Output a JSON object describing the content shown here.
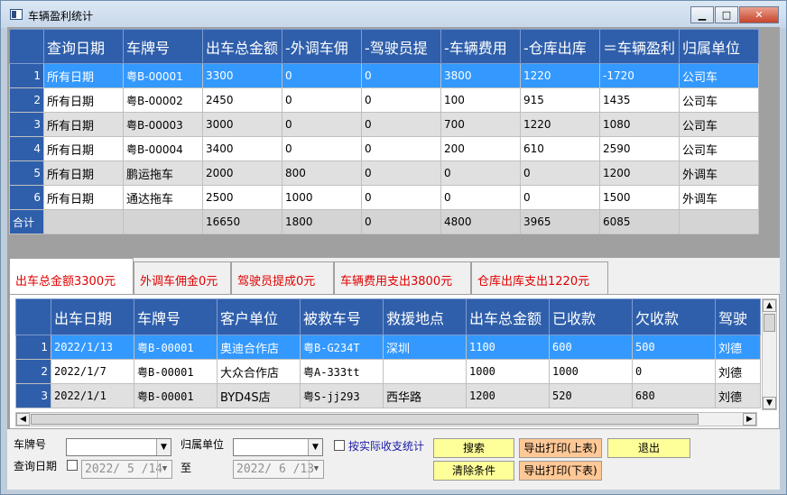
{
  "window": {
    "title": "车辆盈利统计"
  },
  "summary_table": {
    "columns": [
      "查询日期",
      "车牌号",
      "出车总金额",
      "-外调车佣",
      "-驾驶员提",
      "-车辆费用",
      "-仓库出库",
      "＝车辆盈利",
      "归属单位"
    ],
    "rows": [
      {
        "n": "1",
        "cells": [
          "所有日期",
          "粤B-00001",
          "3300",
          "0",
          "0",
          "3800",
          "1220",
          "-1720",
          "公司车"
        ]
      },
      {
        "n": "2",
        "cells": [
          "所有日期",
          "粤B-00002",
          "2450",
          "0",
          "0",
          "100",
          "915",
          "1435",
          "公司车"
        ]
      },
      {
        "n": "3",
        "cells": [
          "所有日期",
          "粤B-00003",
          "3000",
          "0",
          "0",
          "700",
          "1220",
          "1080",
          "公司车"
        ]
      },
      {
        "n": "4",
        "cells": [
          "所有日期",
          "粤B-00004",
          "3400",
          "0",
          "0",
          "200",
          "610",
          "2590",
          "公司车"
        ]
      },
      {
        "n": "5",
        "cells": [
          "所有日期",
          "鹏运拖车",
          "2000",
          "800",
          "0",
          "0",
          "0",
          "1200",
          "外调车"
        ]
      },
      {
        "n": "6",
        "cells": [
          "所有日期",
          "通达拖车",
          "2500",
          "1000",
          "0",
          "0",
          "0",
          "1500",
          "外调车"
        ]
      }
    ],
    "total": {
      "label": "合计",
      "cells": [
        "",
        "",
        "16650",
        "1800",
        "0",
        "4800",
        "3965",
        "6085",
        ""
      ]
    }
  },
  "tabs": [
    "出车总金额3300元",
    "外调车佣金0元",
    "驾驶员提成0元",
    "车辆费用支出3800元",
    "仓库出库支出1220元"
  ],
  "detail_table": {
    "columns": [
      "出车日期",
      "车牌号",
      "客户单位",
      "被救车号",
      "救援地点",
      "出车总金额",
      "已收款",
      "欠收款",
      "驾驶"
    ],
    "rows": [
      {
        "n": "1",
        "cells": [
          "2022/1/13",
          "粤B-00001",
          "奥迪合作店",
          "粤B-G234T",
          "深圳",
          "1100",
          "600",
          "500",
          "刘德"
        ]
      },
      {
        "n": "2",
        "cells": [
          "2022/1/7",
          "粤B-00001",
          "大众合作店",
          "粤A-333tt",
          "",
          "1000",
          "1000",
          "0",
          "刘德"
        ]
      },
      {
        "n": "3",
        "cells": [
          "2022/1/1",
          "粤B-00001",
          "BYD4S店",
          "粤S-jj293",
          "西华路",
          "1200",
          "520",
          "680",
          "刘德"
        ]
      }
    ]
  },
  "filters": {
    "plate_label": "车牌号",
    "date_label": "查询日期",
    "unit_label": "归属单位",
    "to_label": "至",
    "date_from": "2022/ 5 /14",
    "date_to": "2022/ 6 /13",
    "actual_label": "按实际收支统计"
  },
  "buttons": {
    "search": "搜索",
    "export_top": "导出打印(上表)",
    "exit": "退出",
    "clear": "清除条件",
    "export_bottom": "导出打印(下表)"
  }
}
